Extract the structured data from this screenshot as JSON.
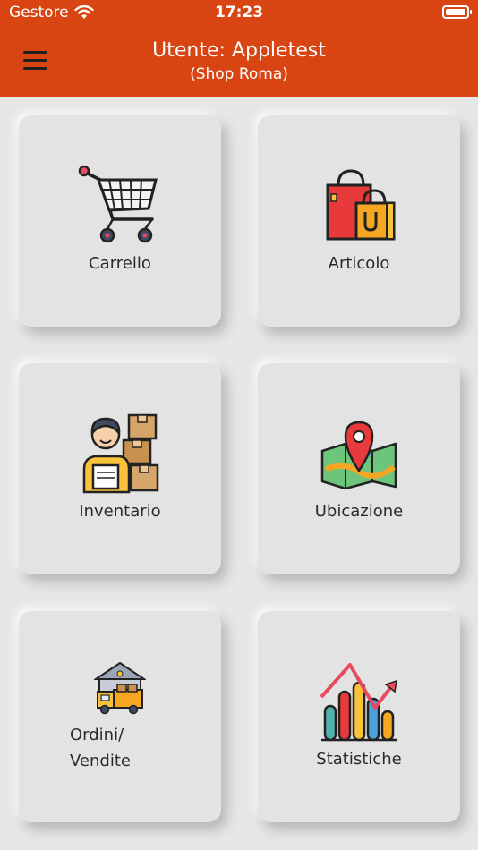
{
  "status_bar": {
    "carrier": "Gestore",
    "time": "17:23"
  },
  "header": {
    "title": "Utente: Appletest",
    "subtitle": "(Shop Roma)",
    "background_color": "#d94413"
  },
  "tiles": [
    {
      "label": "Carrello",
      "icon": "shopping-cart-icon"
    },
    {
      "label": "Articolo",
      "icon": "shopping-bags-icon"
    },
    {
      "label": "Inventario",
      "icon": "worker-boxes-icon"
    },
    {
      "label": "Ubicazione",
      "icon": "map-pin-icon"
    },
    {
      "label_line1": "Ordini/",
      "label_line2": "Vendite",
      "icon": "warehouse-truck-icon"
    },
    {
      "label": "Statistiche",
      "icon": "bar-chart-trend-icon"
    }
  ]
}
